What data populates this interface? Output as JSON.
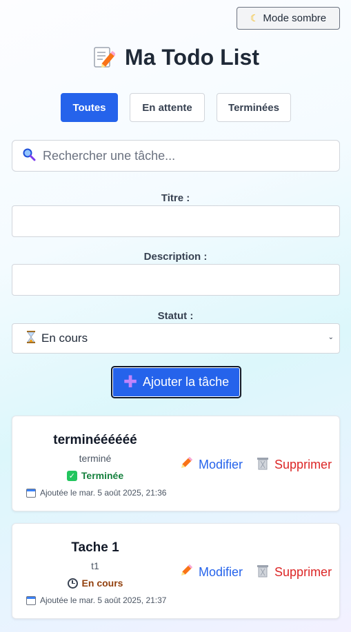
{
  "header": {
    "dark_mode_label": "Mode sombre",
    "title": "Ma Todo List"
  },
  "filters": [
    {
      "label": "Toutes",
      "active": true
    },
    {
      "label": "En attente",
      "active": false
    },
    {
      "label": "Terminées",
      "active": false
    }
  ],
  "search": {
    "placeholder": "Rechercher une tâche..."
  },
  "form": {
    "title_label": "Titre :",
    "title_value": "",
    "description_label": "Description :",
    "description_value": "",
    "status_label": "Statut :",
    "status_value": "En cours",
    "submit_label": "Ajouter la tâche"
  },
  "tasks": [
    {
      "title": "terminéééééé",
      "description": "terminé",
      "status": "Terminée",
      "status_color": "#15803d",
      "date": "Ajoutée le mar. 5 août 2025, 21:36",
      "edit_label": "Modifier",
      "delete_label": "Supprimer"
    },
    {
      "title": "Tache 1",
      "description": "t1",
      "status": "En cours",
      "status_color": "#92400e",
      "date": "Ajoutée le mar. 5 août 2025, 21:37",
      "edit_label": "Modifier",
      "delete_label": "Supprimer"
    }
  ],
  "colors": {
    "accent": "#2563eb",
    "delete": "#dc2626",
    "done": "#15803d",
    "in_progress": "#92400e"
  }
}
